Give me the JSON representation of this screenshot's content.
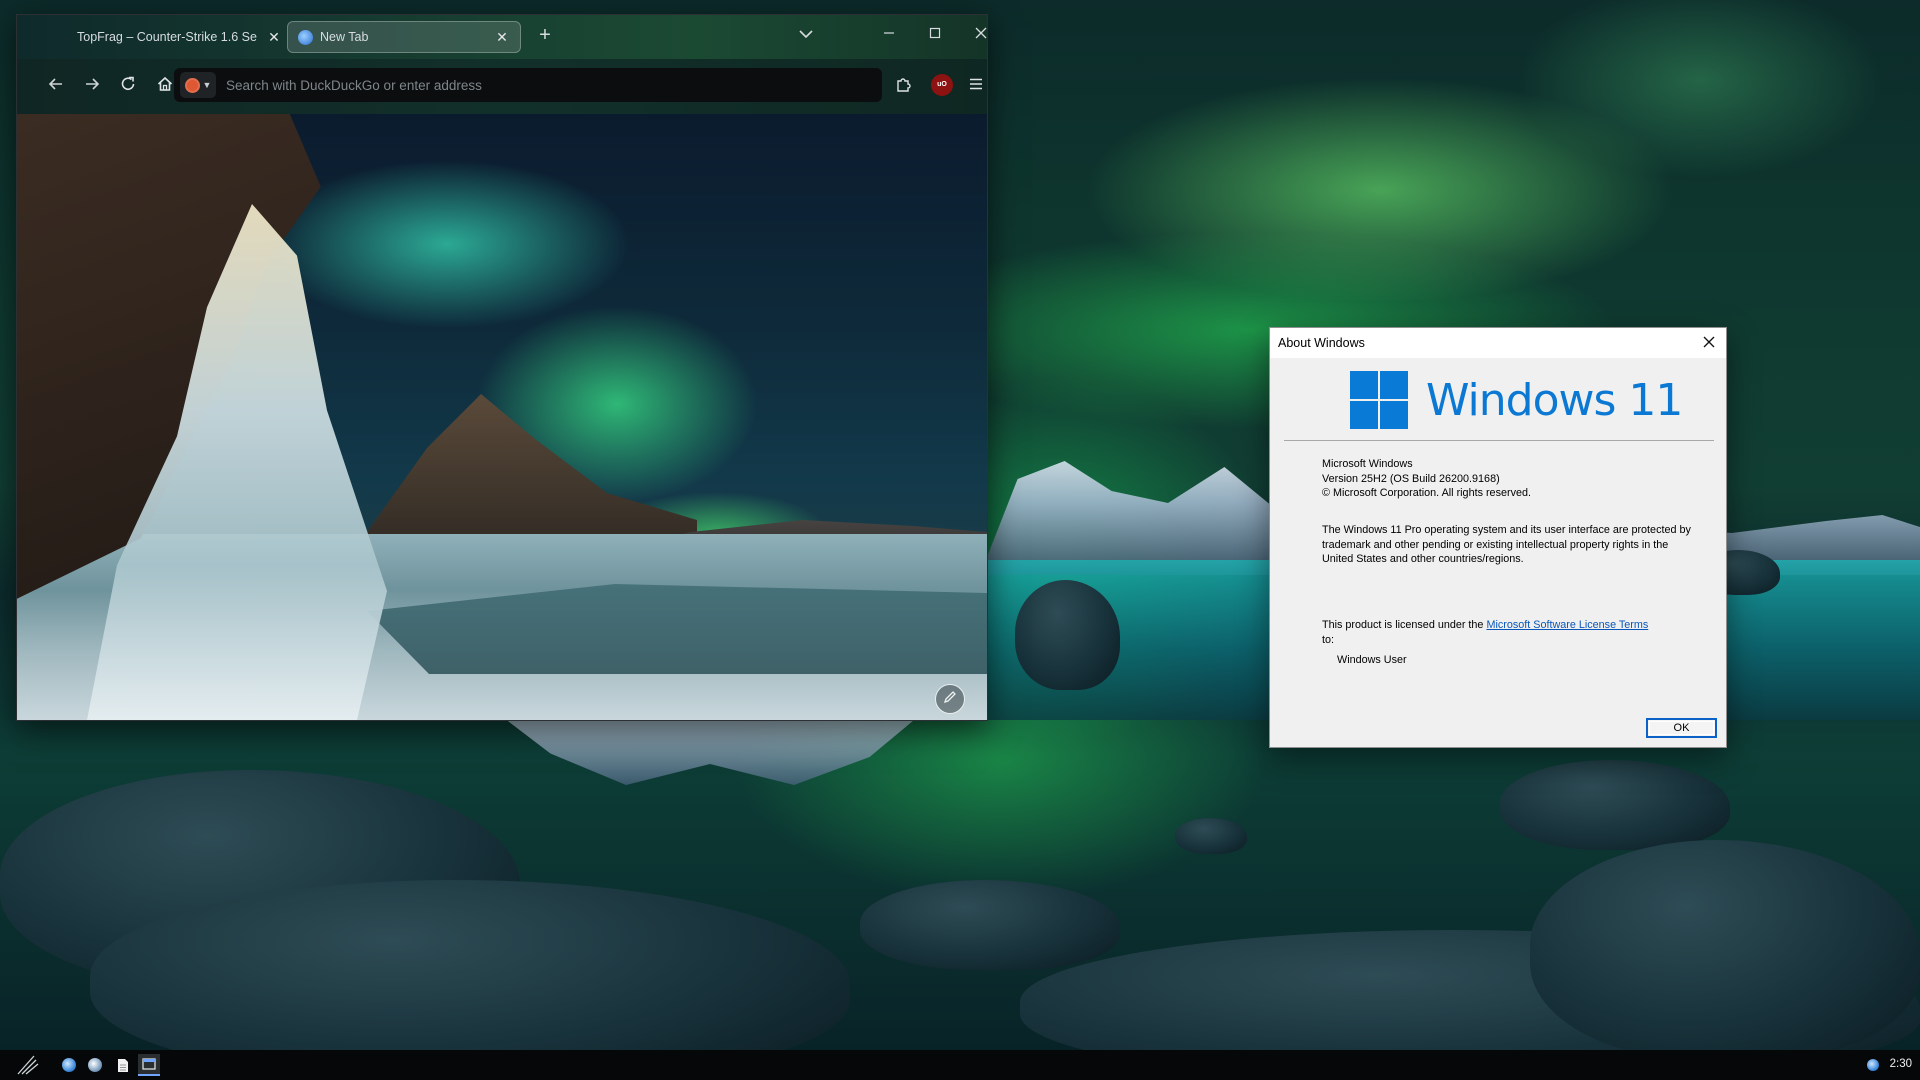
{
  "browser": {
    "tabs": [
      {
        "title": "TopFrag – Counter-Strike 1.6 Se",
        "active": false
      },
      {
        "title": "New Tab",
        "active": true
      }
    ],
    "icons": {
      "back": "arrow-left-icon",
      "forward": "arrow-right-icon",
      "reload": "reload-icon",
      "home": "home-icon",
      "extensions": "puzzle-icon",
      "menu": "hamburger-icon",
      "search_engine": "duckduckgo-icon",
      "ublock": "ublock-origin-icon",
      "edit": "pencil-icon"
    },
    "address_placeholder": "Search with DuckDuckGo or enter address",
    "ublock_label": "uO"
  },
  "about_dialog": {
    "title": "About Windows",
    "wordmark": "Windows 11",
    "product_name": "Microsoft Windows",
    "version": "Version 25H2 (OS Build 26200.9168)",
    "copyright": "© Microsoft Corporation. All rights reserved.",
    "legal_text": "The Windows 11 Pro operating system and its user interface are protected by trademark and other pending or existing intellectual property rights in the United States and other countries/regions.",
    "license_prefix": "This product is licensed under the ",
    "license_link": "Microsoft Software License Terms",
    "license_suffix": " to:",
    "licensed_user": "Windows User",
    "ok_label": "OK",
    "logo_color": "#0a7ad7"
  },
  "taskbar": {
    "items": [
      "app-launcher-icon",
      "steam-icon",
      "steam-icon",
      "file-icon",
      "window-icon"
    ],
    "tray": [
      "steam-tray-icon"
    ],
    "clock": "2:30"
  }
}
